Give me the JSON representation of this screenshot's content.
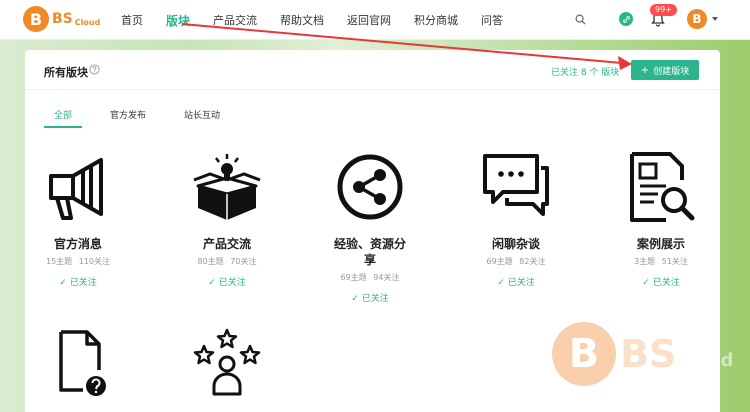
{
  "logo": {
    "letter": "B",
    "name": "BS",
    "sub": "Cloud"
  },
  "nav": [
    "首页",
    "版块",
    "产品交流",
    "帮助文档",
    "返回官网",
    "积分商城",
    "问答"
  ],
  "notifications": {
    "badge": "99+"
  },
  "user": {
    "avatar_letter": "B"
  },
  "panel": {
    "title": "所有版块",
    "followed": "已关注 8 个 版块",
    "create_button": "创建版块"
  },
  "tabs": [
    "全部",
    "官方发布",
    "站长互动"
  ],
  "boards": [
    {
      "name": "官方消息",
      "topics": "15主题",
      "follows": "110关注",
      "status": "已关注",
      "icon": "megaphone-icon"
    },
    {
      "name": "产品交流",
      "topics": "80主题",
      "follows": "70关注",
      "status": "已关注",
      "icon": "open-box-icon"
    },
    {
      "name": "经验、资源分享",
      "topics": "69主题",
      "follows": "94关注",
      "status": "已关注",
      "icon": "share-icon"
    },
    {
      "name": "闲聊杂谈",
      "topics": "69主题",
      "follows": "82关注",
      "status": "已关注",
      "icon": "chat-bubbles-icon"
    },
    {
      "name": "案例展示",
      "topics": "3主题",
      "follows": "51关注",
      "status": "已关注",
      "icon": "document-search-icon"
    },
    {
      "name": "",
      "icon": "document-question-icon"
    },
    {
      "name": "",
      "icon": "user-stars-icon"
    }
  ],
  "watermark": {
    "letter": "B",
    "text": "BS",
    "sub": "Cloud"
  },
  "colors": {
    "accent": "#2ab58a",
    "brand": "#f08a24",
    "badge": "#ff4d4f",
    "arrow": "#e53935"
  }
}
